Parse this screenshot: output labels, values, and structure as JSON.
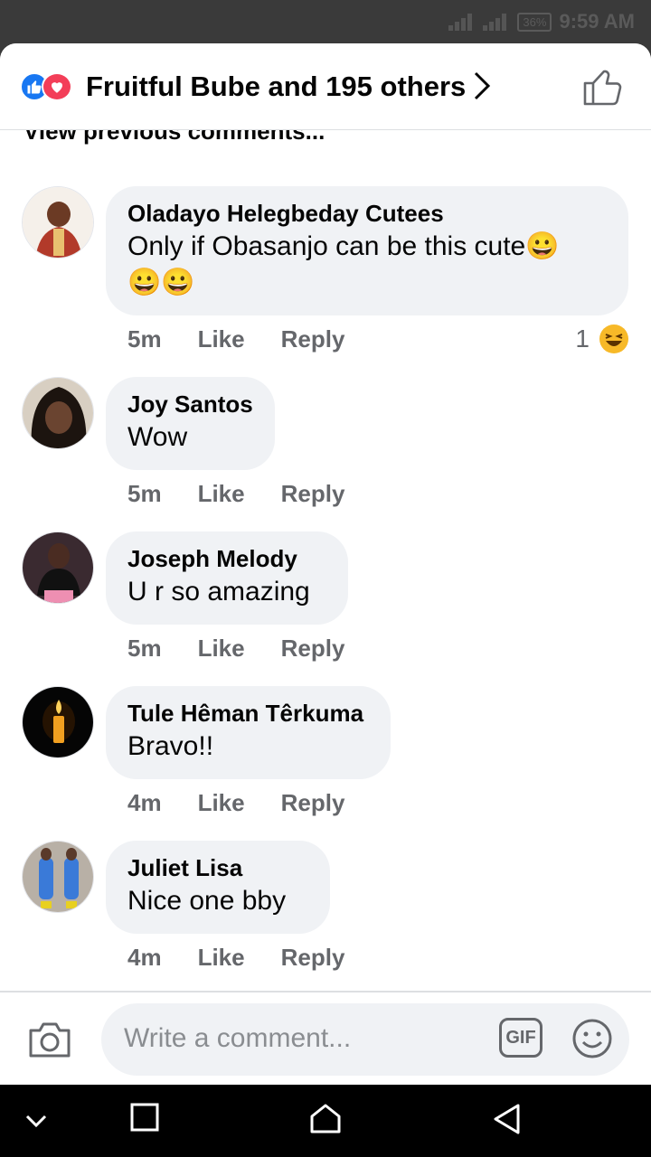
{
  "status_bar": {
    "battery": "36%",
    "time": "9:59 AM"
  },
  "header": {
    "title": "Fruitful Bube and 195 others",
    "reaction_icons": [
      "like-icon",
      "love-icon"
    ]
  },
  "view_previous": "View previous comments...",
  "comments": [
    {
      "name": "Oladayo Helegbeday Cutees",
      "text_line1": "Only if Obasanjo can be this cute😀",
      "text_line2": "😀😀",
      "time": "5m",
      "like": "Like",
      "reply": "Reply",
      "reaction_count": "1",
      "reaction_icon": "haha-icon"
    },
    {
      "name": "Joy Santos",
      "text": "Wow",
      "time": "5m",
      "like": "Like",
      "reply": "Reply"
    },
    {
      "name": "Joseph Melody",
      "text": "U r so amazing",
      "time": "5m",
      "like": "Like",
      "reply": "Reply"
    },
    {
      "name": "Tule Hêman Têrkuma",
      "text": "Bravo!!",
      "time": "4m",
      "like": "Like",
      "reply": "Reply"
    },
    {
      "name": "Juliet Lisa",
      "text": "Nice one bby",
      "time": "4m",
      "like": "Like",
      "reply": "Reply"
    }
  ],
  "composer": {
    "placeholder": "Write a comment...",
    "gif_label": "GIF"
  },
  "colors": {
    "accent": "#1877f2",
    "love": "#f33e58",
    "bubble": "#f0f2f5",
    "secondary_text": "#65676b"
  }
}
